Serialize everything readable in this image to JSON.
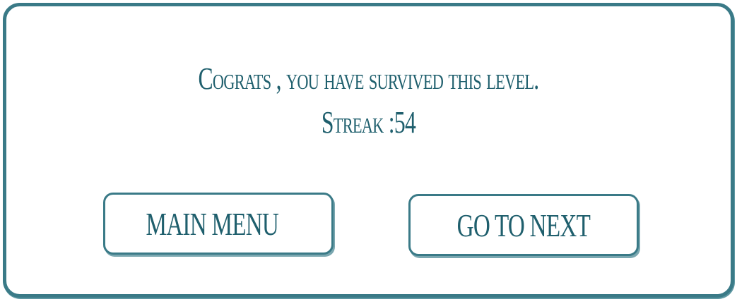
{
  "dialog": {
    "message": "Cograts , you have survived this level.",
    "streak": "Streak :54"
  },
  "buttons": {
    "main_menu": "MAIN MENU",
    "go_to_next": "GO TO NEXT"
  }
}
